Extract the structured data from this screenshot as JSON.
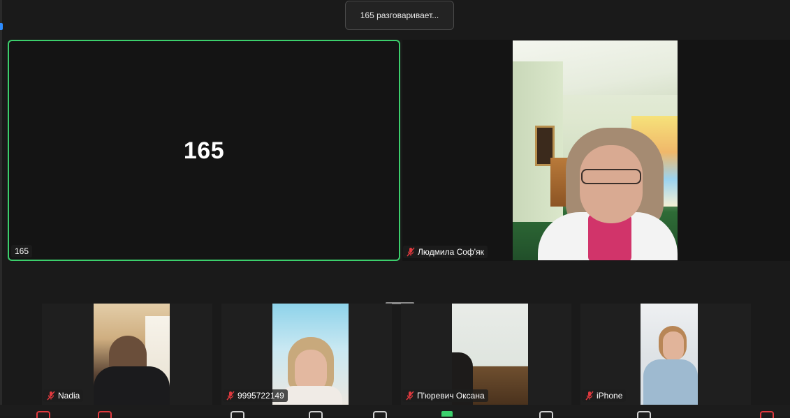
{
  "banner": {
    "talking": "165 разговаривает..."
  },
  "active_speaker": {
    "big_label": "165",
    "name": "165"
  },
  "participants": {
    "main_video_name": "Людмила Соф'як",
    "thumbs": [
      {
        "name": "Nadia"
      },
      {
        "name": "9995722149"
      },
      {
        "name": "П'юревич Оксана"
      },
      {
        "name": "iPhone"
      }
    ]
  },
  "colors": {
    "active_border": "#3ccf6c",
    "mic_muted": "#e0393e",
    "accent": "#2d8cff"
  },
  "icons": {
    "mic_muted": "mic-muted-icon"
  }
}
